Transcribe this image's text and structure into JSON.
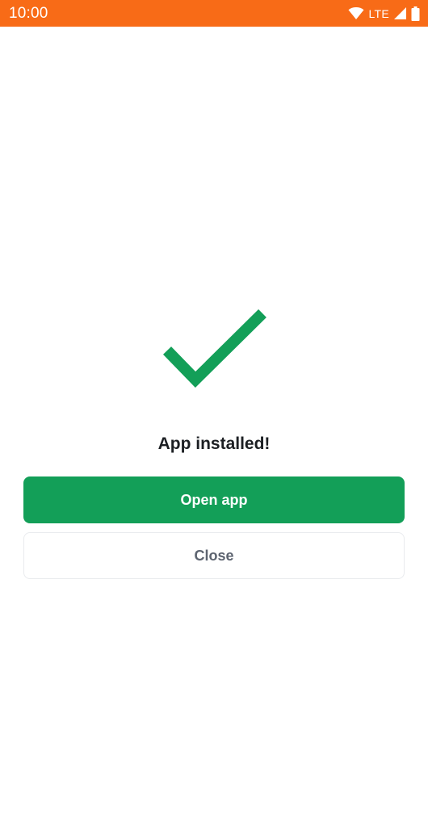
{
  "status_bar": {
    "time": "10:00",
    "network": "LTE",
    "icons": [
      "wifi-icon",
      "cell-signal-icon",
      "battery-icon"
    ],
    "color": "#f86b17"
  },
  "main": {
    "icon": "checkmark-icon",
    "icon_color": "#139f58",
    "title": "App installed!",
    "primary_button_label": "Open app",
    "secondary_button_label": "Close"
  }
}
